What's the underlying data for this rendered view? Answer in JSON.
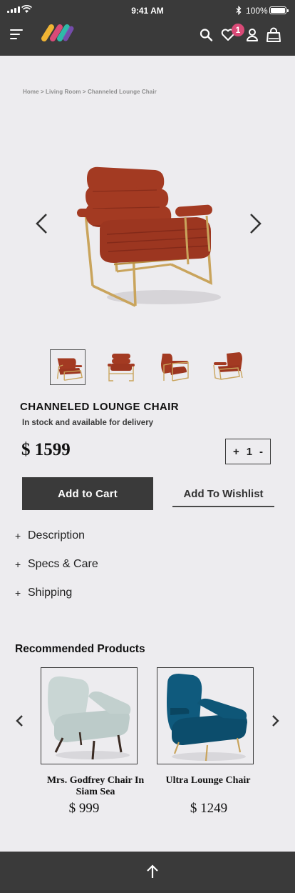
{
  "status_bar": {
    "time": "9:41 AM",
    "battery": "100%"
  },
  "header": {
    "menu_icon": "hamburger-menu-icon",
    "logo": "brand-logo",
    "icons": [
      "search-icon",
      "heart-icon",
      "user-icon",
      "shopping-bag-icon"
    ],
    "wishlist_count": "1"
  },
  "breadcrumb": "Home > Living Room > Channeled Lounge Chair",
  "gallery": {
    "thumbnail_count": 4,
    "active_index": 0
  },
  "product": {
    "title": "CHANNELED LOUNGE CHAIR",
    "availability": "In stock and available for delivery",
    "price": "$ 1599",
    "quantity": {
      "increase": "+",
      "value": "1",
      "decrease": "-"
    },
    "add_to_cart": "Add to Cart",
    "add_to_wishlist": "Add To Wishlist"
  },
  "accordion": [
    {
      "icon": "+",
      "label": "Description"
    },
    {
      "icon": "+",
      "label": "Specs & Care"
    },
    {
      "icon": "+",
      "label": "Shipping"
    }
  ],
  "recommended": {
    "title": "Recommended Products",
    "items": [
      {
        "name": "Mrs. Godfrey Chair In Siam Sea",
        "price": "$ 999"
      },
      {
        "name": "Ultra Lounge Chair",
        "price": "$ 1249"
      }
    ]
  },
  "colors": {
    "bar": "#3a3a3a",
    "background": "#edecef",
    "badge": "#d94a77",
    "chair_rust": "#a33a22",
    "brass": "#c9a45c",
    "teal": "#0f5a7d",
    "mint": "#c9d6d4"
  }
}
